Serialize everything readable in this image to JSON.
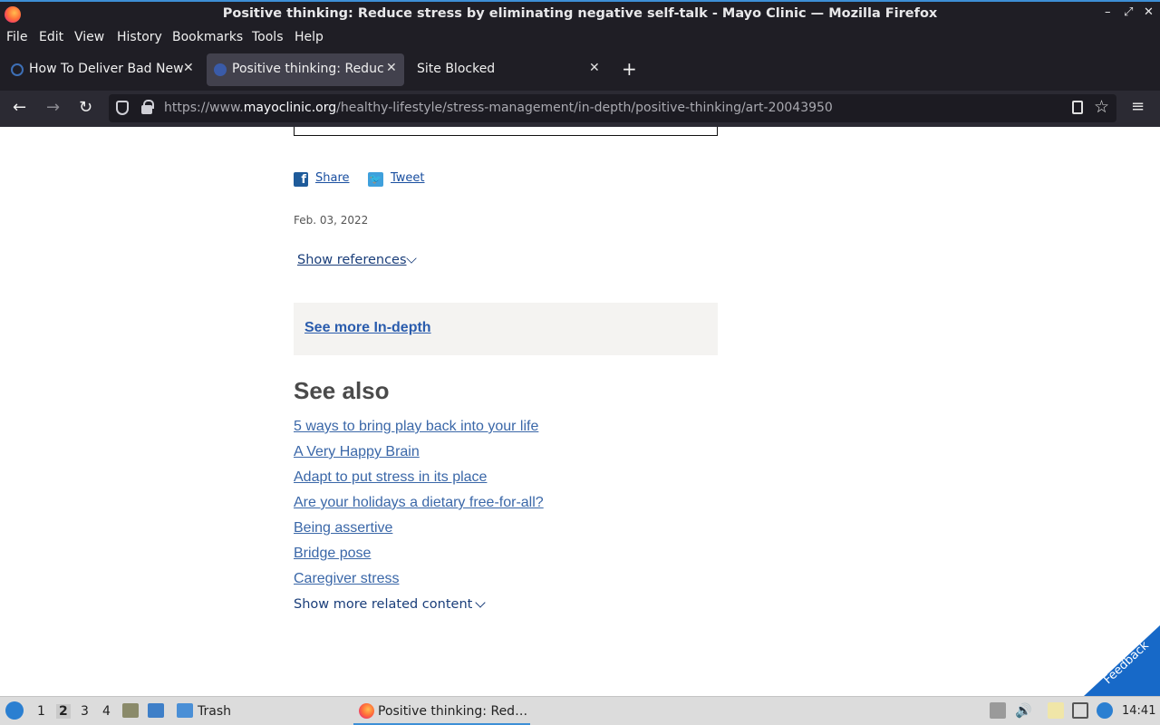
{
  "window": {
    "title": "Positive thinking: Reduce stress by eliminating negative self-talk - Mayo Clinic — Mozilla Firefox",
    "controls": [
      "–",
      "⤢",
      "✕"
    ]
  },
  "menu": [
    "File",
    "Edit",
    "View",
    "History",
    "Bookmarks",
    "Tools",
    "Help"
  ],
  "tabs": [
    {
      "label": "How To Deliver Bad News",
      "active": false
    },
    {
      "label": "Positive thinking: Reduce",
      "active": true
    },
    {
      "label": "Site Blocked",
      "active": false
    }
  ],
  "tab_close": "✕",
  "new_tab": "+",
  "nav": {
    "back": "←",
    "forward": "→",
    "reload": "↻",
    "url_prefix": "https://www.",
    "url_host": "mayoclinic.org",
    "url_path": "/healthy-lifestyle/stress-management/in-depth/positive-thinking/art-20043950",
    "bookmark_star": "☆",
    "menu": "≡"
  },
  "page": {
    "share": {
      "facebook_icon": "f",
      "facebook": "Share",
      "twitter_icon": "🐦",
      "twitter": "Tweet"
    },
    "date": "Feb. 03, 2022",
    "show_references": "Show references",
    "see_more": "See more In-depth",
    "see_also_heading": "See also",
    "related": [
      "5 ways to bring play back into your life",
      "A Very Happy Brain",
      "Adapt to put stress in its place",
      "Are your holidays a dietary free-for-all?",
      "Being assertive",
      "Bridge pose",
      "Caregiver stress"
    ],
    "show_more_related": "Show more related content",
    "feedback": "Feedback"
  },
  "taskbar": {
    "workspaces": [
      "1",
      "2",
      "3",
      "4"
    ],
    "active_workspace": "2",
    "trash": "Trash",
    "task": "Positive thinking: Red…",
    "clock": "14:41"
  },
  "colors": {
    "titlebar": "#1f1e25",
    "tab_active": "#42414d",
    "navbar": "#2b2a33",
    "link": "#3a67a8",
    "feedback": "#1769c8",
    "taskbar": "#dcdcdc"
  }
}
